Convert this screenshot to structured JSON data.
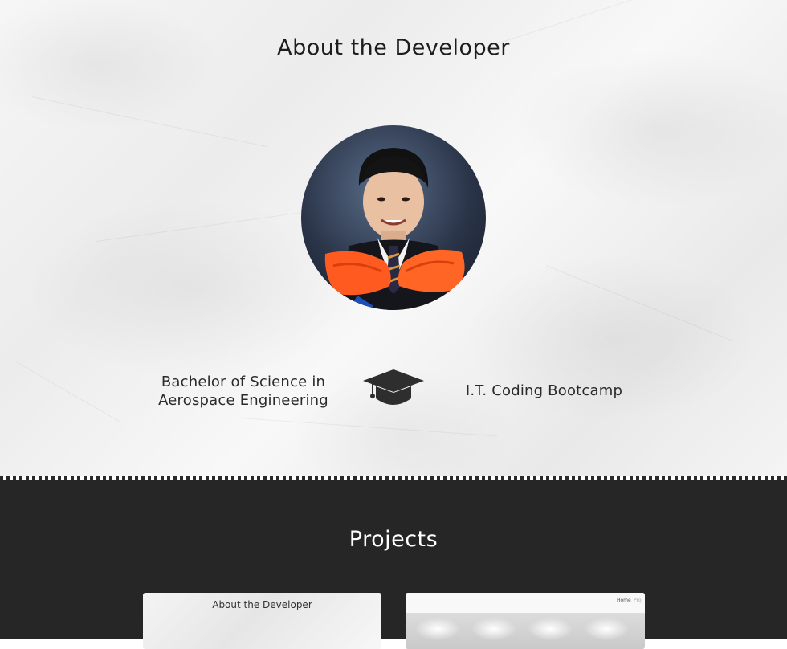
{
  "about": {
    "title": "About the Developer",
    "education_left": "Bachelor of Science in Aerospace Engineering",
    "education_right": "I.T. Coding Bootcamp",
    "cap_icon": "graduation-cap-icon"
  },
  "projects": {
    "title": "Projects",
    "cards": [
      {
        "preview_title": "About the Developer"
      },
      {
        "nav_items": [
          "Home",
          "Proj"
        ]
      }
    ]
  },
  "colors": {
    "dark_section": "#262626",
    "accent_sash": "#ff5a1f"
  }
}
